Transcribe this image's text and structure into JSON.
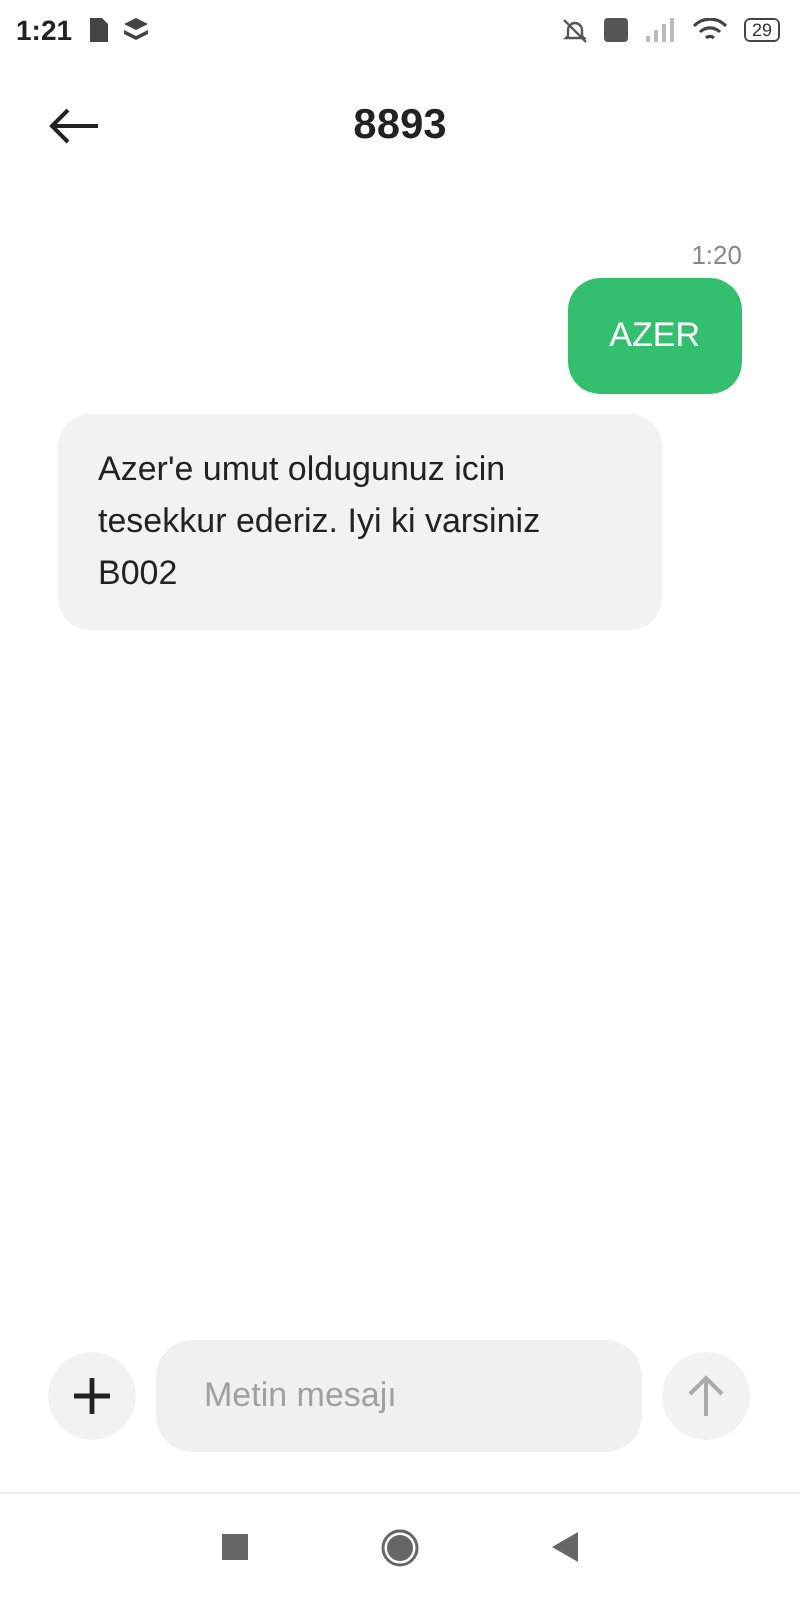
{
  "status_bar": {
    "time": "1:21",
    "battery": "29"
  },
  "header": {
    "title": "8893"
  },
  "messages": [
    {
      "kind": "outgoing",
      "time": "1:20",
      "text": "AZER"
    },
    {
      "kind": "incoming",
      "text": "Azer'e umut oldugunuz icin tesekkur ederiz. Iyi ki varsiniz B002"
    }
  ],
  "composer": {
    "placeholder": "Metin mesajı"
  }
}
